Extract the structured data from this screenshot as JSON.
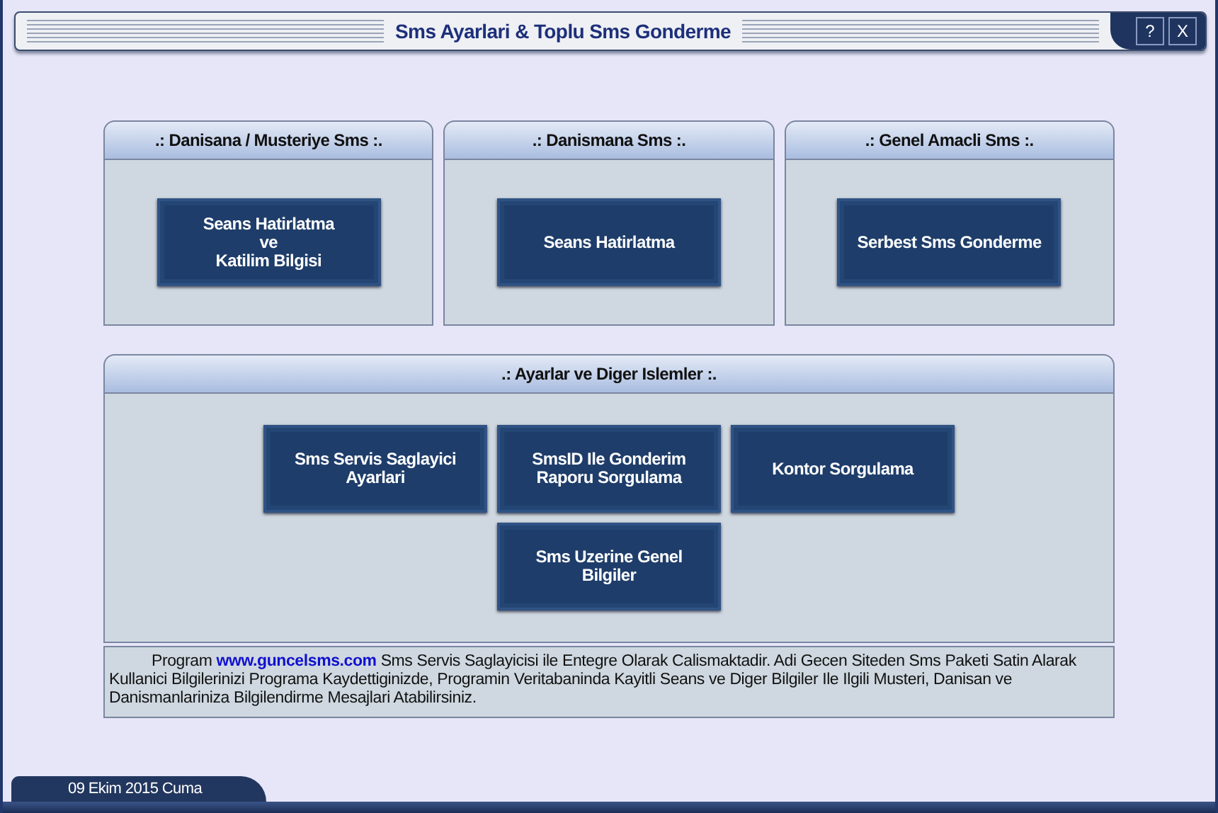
{
  "window": {
    "title": "Sms Ayarlari & Toplu Sms Gonderme",
    "controls": [
      "?",
      "X"
    ]
  },
  "top_groups": [
    {
      "title": ".: Danisana / Musteriye Sms :.",
      "button": "Seans Hatirlatma\nve\nKatilim Bilgisi"
    },
    {
      "title": ".: Danismana Sms :.",
      "button": "Seans Hatirlatma"
    },
    {
      "title": ".: Genel Amacli Sms :.",
      "button": "Serbest Sms Gonderme"
    }
  ],
  "settings_group": {
    "title": ".: Ayarlar ve Diger Islemler :.",
    "buttons": [
      "Sms Servis Saglayici\nAyarlari",
      "SmsID Ile Gonderim\nRaporu Sorgulama",
      "Kontor Sorgulama",
      "Sms Uzerine Genel\nBilgiler"
    ]
  },
  "info": {
    "before": "Program ",
    "link": "www.guncelsms.com",
    "after": " Sms Servis Saglayicisi ile Entegre Olarak Calismaktadir. Adi Gecen Siteden Sms Paketi Satin Alarak Kullanici Bilgilerinizi Programa Kaydettiginizde, Programin Veritabaninda Kayitli Seans ve Diger Bilgiler Ile Ilgili Musteri, Danisan ve Danismanlariniza Bilgilendirme Mesajlari Atabilirsiniz."
  },
  "status_bar": {
    "date": "09 Ekim 2015 Cuma"
  }
}
